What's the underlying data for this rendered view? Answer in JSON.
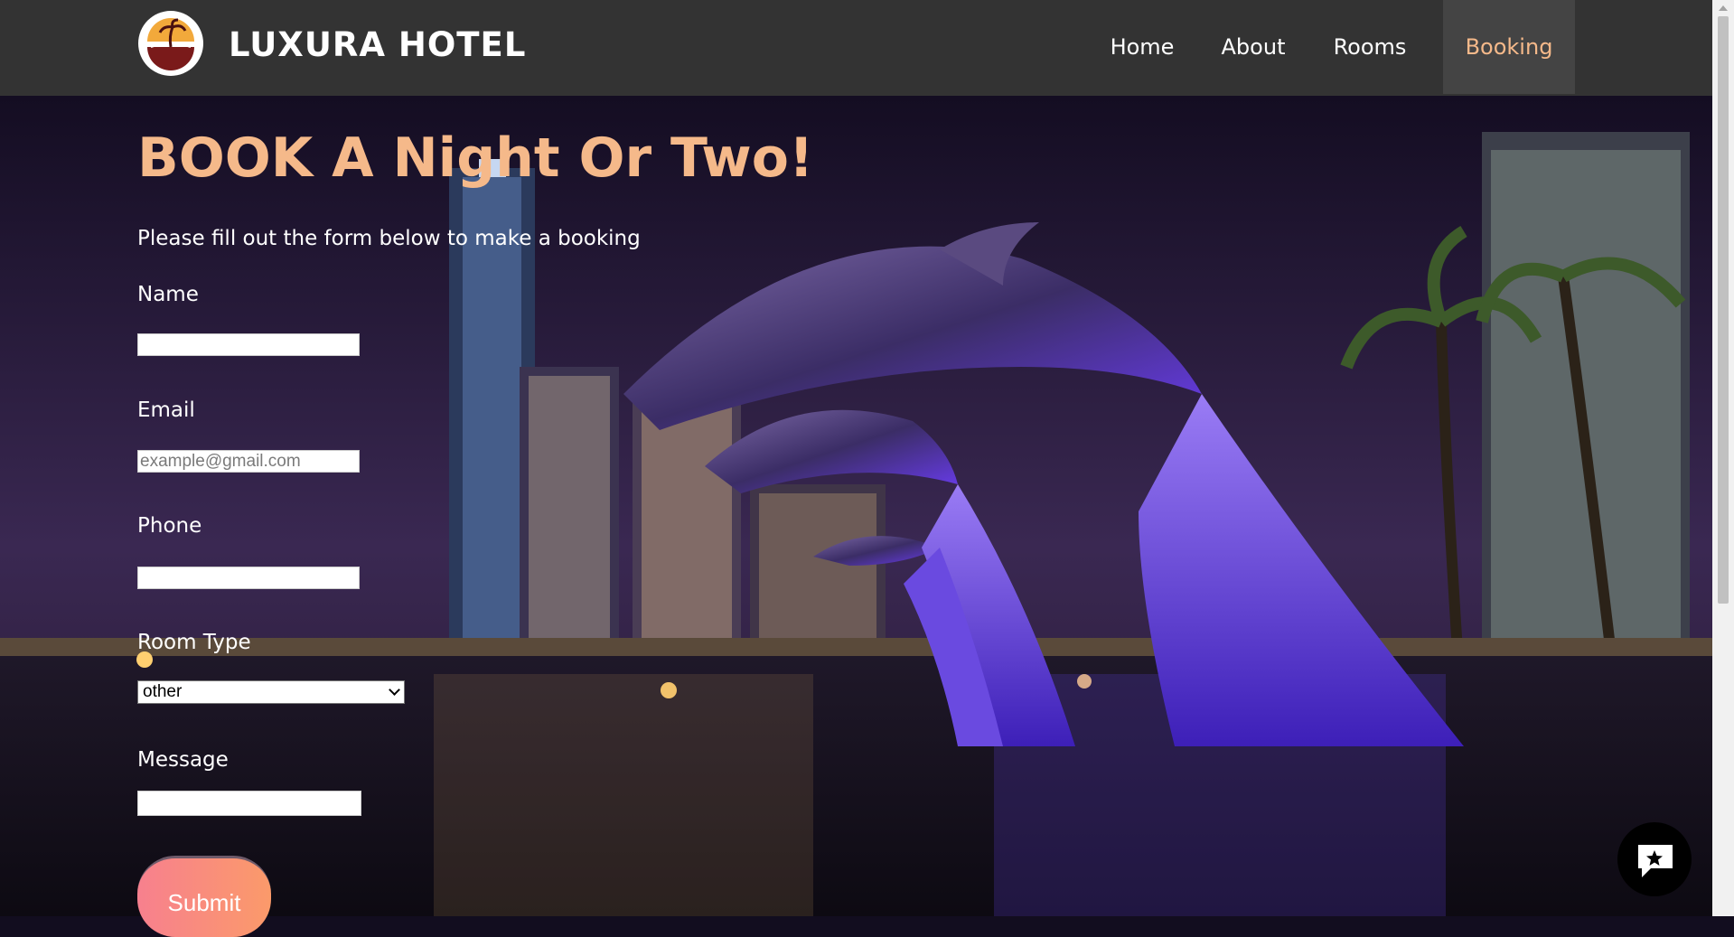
{
  "header": {
    "brand": "LUXURA HOTEL",
    "nav": [
      {
        "label": "Home",
        "active": false
      },
      {
        "label": "About",
        "active": false
      },
      {
        "label": "Rooms",
        "active": false
      },
      {
        "label": "Booking",
        "active": true
      }
    ]
  },
  "main": {
    "heading": "BOOK A Night Or Two!",
    "intro": "Please fill out the form below to make a booking",
    "form": {
      "name_label": "Name",
      "name_value": "",
      "email_label": "Email",
      "email_placeholder": "example@gmail.com",
      "phone_label": "Phone",
      "phone_value": "",
      "room_type_label": "Room Type",
      "room_type_selected": "other",
      "message_label": "Message",
      "message_value": "",
      "submit_label": "Submit"
    }
  },
  "chat_widget": {
    "icon": "chat-icon"
  },
  "colors": {
    "accent": "#f5b98a",
    "navbar": "#333333",
    "active_tab": "#444444",
    "submit_gradient": [
      "#f7808e",
      "#fb9a6a"
    ]
  }
}
